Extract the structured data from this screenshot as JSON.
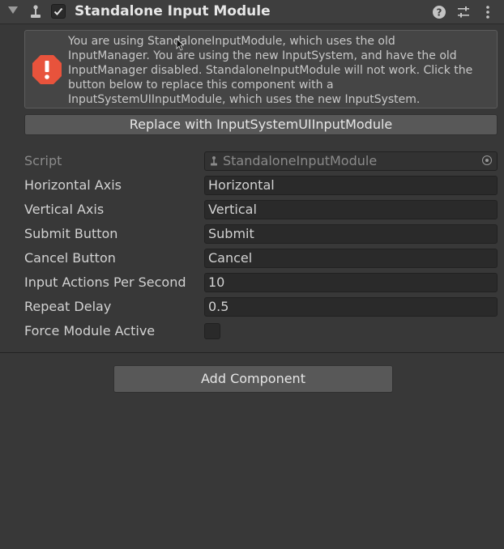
{
  "component": {
    "title": "Standalone Input Module",
    "enabled": true,
    "icons": {
      "foldout": "foldout-expanded-icon",
      "component": "input-module-icon",
      "help": "help-icon",
      "presets": "presets-icon",
      "menu": "more-menu-icon"
    }
  },
  "warning": {
    "icon": "error-icon",
    "lines": [
      "You are using StandaloneInputModule, which uses the old",
      "InputManager. You are using the new InputSystem, and have the old",
      "InputManager disabled. StandaloneInputModule will not work. Click the",
      "button below to replace this component with a",
      "InputSystemUIInputModule, which uses the new InputSystem."
    ],
    "button_label": "Replace with InputSystemUIInputModule"
  },
  "properties": {
    "script": {
      "label": "Script",
      "value": "StandaloneInputModule"
    },
    "horizontal_axis": {
      "label": "Horizontal Axis",
      "value": "Horizontal"
    },
    "vertical_axis": {
      "label": "Vertical Axis",
      "value": "Vertical"
    },
    "submit_button": {
      "label": "Submit Button",
      "value": "Submit"
    },
    "cancel_button": {
      "label": "Cancel Button",
      "value": "Cancel"
    },
    "input_actions_per_second": {
      "label": "Input Actions Per Second",
      "value": "10"
    },
    "repeat_delay": {
      "label": "Repeat Delay",
      "value": "0.5"
    },
    "force_module_active": {
      "label": "Force Module Active",
      "checked": false
    }
  },
  "footer": {
    "add_component_label": "Add Component"
  },
  "colors": {
    "background": "#383838",
    "field": "#2a2a2a",
    "button": "#585858",
    "warning": "#e8533c"
  }
}
